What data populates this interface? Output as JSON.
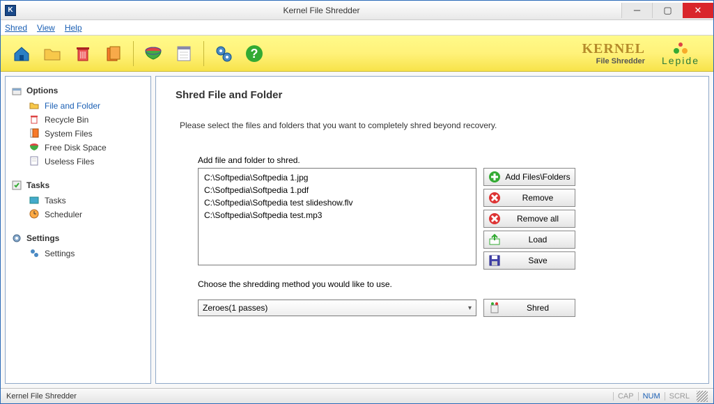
{
  "window": {
    "title": "Kernel File Shredder"
  },
  "menu": {
    "shred": "Shred",
    "view": "View",
    "help": "Help"
  },
  "brand": {
    "name": "KERNEL",
    "sub": "File Shredder",
    "vendor": "Lepide"
  },
  "sidebar": {
    "options": {
      "head": "Options",
      "items": [
        "File and Folder",
        "Recycle Bin",
        "System Files",
        "Free Disk Space",
        "Useless Files"
      ]
    },
    "tasks": {
      "head": "Tasks",
      "items": [
        "Tasks",
        "Scheduler"
      ]
    },
    "settings": {
      "head": "Settings",
      "items": [
        "Settings"
      ]
    }
  },
  "main": {
    "title": "Shred File and Folder",
    "instruction": "Please select the files and folders that you want to completely shred beyond recovery.",
    "addLabel": "Add file and folder to shred.",
    "files": [
      "C:\\Softpedia\\Softpedia 1.jpg",
      "C:\\Softpedia\\Softpedia 1.pdf",
      "C:\\Softpedia\\Softpedia test slideshow.flv",
      "C:\\Softpedia\\Softpedia test.mp3"
    ],
    "methodLabel": "Choose the shredding method you would like to use.",
    "method": "Zeroes(1 passes)"
  },
  "buttons": {
    "add": "Add Files\\Folders",
    "remove": "Remove",
    "removeAll": "Remove all",
    "load": "Load",
    "save": "Save",
    "shred": "Shred"
  },
  "status": {
    "text": "Kernel File Shredder",
    "cap": "CAP",
    "num": "NUM",
    "scrl": "SCRL"
  }
}
